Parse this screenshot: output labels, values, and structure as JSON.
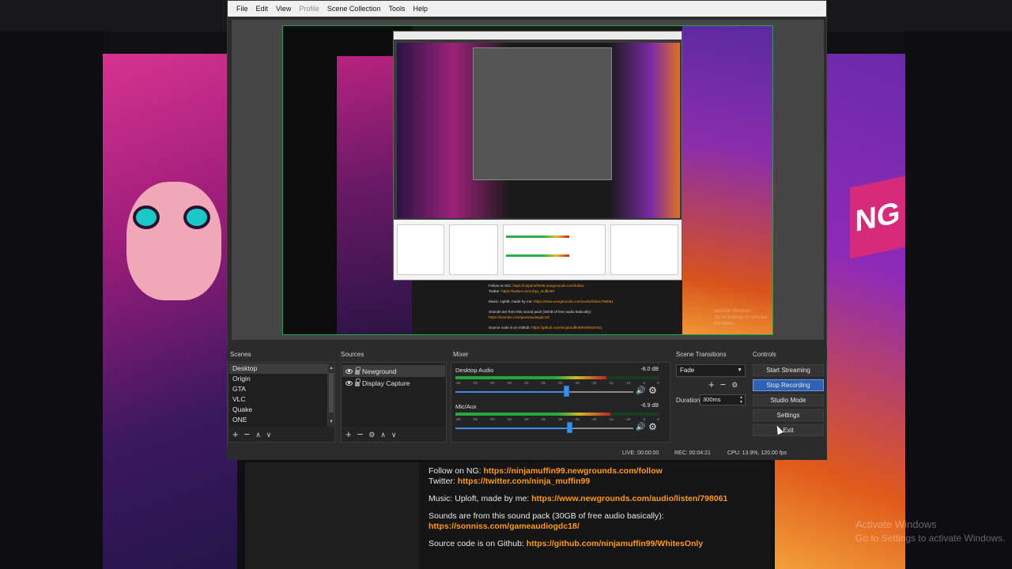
{
  "menu": [
    "File",
    "Edit",
    "View",
    "Profile",
    "Scene Collection",
    "Tools",
    "Help"
  ],
  "docks": {
    "scenes_title": "Scenes",
    "sources_title": "Sources",
    "mixer_title": "Mixer",
    "transitions_title": "Scene Transitions",
    "controls_title": "Controls"
  },
  "scenes": [
    "Desktop",
    "Origin",
    "GTA",
    "VLC",
    "Quake",
    "ONE"
  ],
  "sources": [
    "Newground",
    "Display Capture"
  ],
  "mixer": {
    "channels": [
      {
        "name": "Desktop Audio",
        "db": "-8.0 dB",
        "level": 0.74,
        "fader": 0.62
      },
      {
        "name": "Mic/Aux",
        "db": "-6.9 dB",
        "level": 0.76,
        "fader": 0.64
      }
    ],
    "ticks": [
      "-60",
      "-55",
      "-50",
      "-45",
      "-40",
      "-35",
      "-30",
      "-25",
      "-20",
      "-15",
      "-10",
      "-5",
      "0"
    ]
  },
  "transitions": {
    "selected": "Fade",
    "duration_label": "Duration",
    "duration_value": "300ms"
  },
  "controls": {
    "start_streaming": "Start Streaming",
    "stop_recording": "Stop Recording",
    "studio_mode": "Studio Mode",
    "settings": "Settings",
    "exit": "Exit"
  },
  "status": {
    "live": "LIVE: 00:00:00",
    "rec": "REC: 00:04:21",
    "cpu": "CPU: 13.9%, 120.00 fps"
  },
  "overlay_text": {
    "follow_label": "Follow on NG: ",
    "follow_link": "https://ninjamuffin99.newgrounds.com/follow",
    "twitter_label": "Twitter: ",
    "twitter_link": "https://twitter.com/ninja_muffin99",
    "music_label": "Music: Uploft, made by me: ",
    "music_link": "https://www.newgrounds.com/audio/listen/798061",
    "sounds_line": "Sounds are from this sound pack (30GB of free audio basically):",
    "sounds_link": "https://sonniss.com/gameaudiogdc18/",
    "source_label": "Source code is on Github: ",
    "source_link": "https://github.com/ninjamuffin99/WhitesOnly"
  },
  "watermark": {
    "line1": "Activate Windows",
    "line2": "Go to Settings to activate Windows."
  },
  "wall_sign": "NG",
  "colors": {
    "accent_blue": "#2f62b5",
    "link_orange": "#ff9a1f",
    "preview_border": "#1fa64a"
  }
}
